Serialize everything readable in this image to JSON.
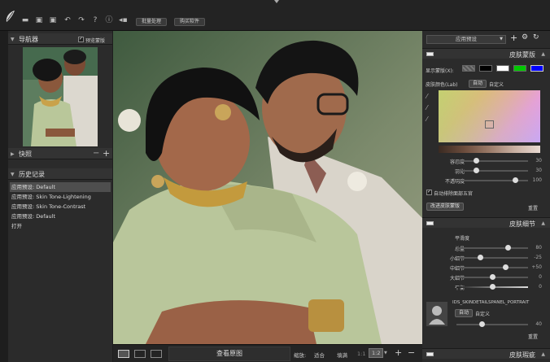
{
  "toolbar": {
    "batch_button": "批量处理",
    "buy_button": "购买软件"
  },
  "navigator": {
    "title": "导航器",
    "preview_label": "预览蒙版"
  },
  "snapshots": {
    "title": "快照"
  },
  "history": {
    "title": "历史记录",
    "items": [
      "应用预设: Default",
      "应用预设: Skin Tone-Lightening",
      "应用预设: Skin Tone-Contrast",
      "应用预设: Default",
      "打开"
    ]
  },
  "bottom": {
    "view_original": "查看原图",
    "zoom_label": "缩放:",
    "fit": "适合",
    "fill": "填满",
    "ratio_1_1": "1:1",
    "ratio_1_2": "1:2"
  },
  "right": {
    "preset_select": "应用预设",
    "skin_mask": {
      "title": "皮肤蒙版",
      "show_mask_label": "显示蒙版(X):",
      "skin_color_label": "皮肤颜色(Lab)",
      "auto": "自动",
      "custom": "自定义",
      "sliders": [
        {
          "label": "容忍度",
          "value": "30",
          "pos": 0.27
        },
        {
          "label": "羽化",
          "value": "30",
          "pos": 0.27
        },
        {
          "label": "不透明度",
          "value": "100",
          "pos": 0.82
        }
      ],
      "auto_exclude_label": "自动排除面部五官",
      "improve_button": "改进皮肤蒙版",
      "reset": "重置"
    },
    "skin_detail": {
      "title": "皮肤细节",
      "smooth_title": "平滑度",
      "sliders": [
        {
          "label": "总量",
          "value": "80",
          "pos": 0.72
        },
        {
          "label": "小细节",
          "value": "-25",
          "pos": 0.33
        },
        {
          "label": "中细节",
          "value": "+50",
          "pos": 0.68
        },
        {
          "label": "大细节",
          "value": "0",
          "pos": 0.5
        },
        {
          "label": "平衡",
          "value": "0",
          "pos": 0.5
        }
      ],
      "portrait_label": "IDS_SKINDETAILSPANEL_PORTRAIT",
      "auto": "自动",
      "custom": "自定义",
      "amount_value": "40",
      "amount_pos": 0.35,
      "reset": "重置"
    },
    "skin_blemish": {
      "title": "皮肤瑕疵"
    }
  },
  "colors": {
    "mask_white": "#ffffff",
    "mask_green": "#00c800",
    "mask_blue": "#0000ff",
    "mask_black": "#000000"
  }
}
